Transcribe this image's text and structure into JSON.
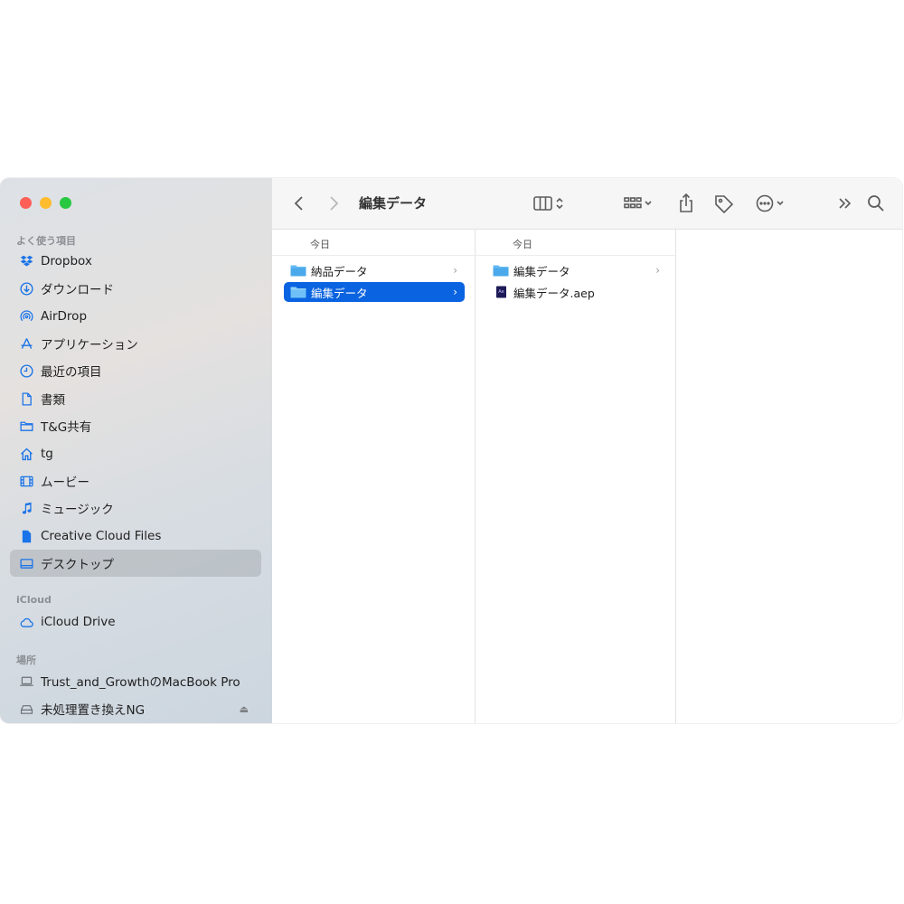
{
  "window": {
    "title": "編集データ"
  },
  "sidebar": {
    "favorites_header": "よく使う項目",
    "favorites": [
      {
        "label": "Dropbox",
        "icon": "dropbox-icon"
      },
      {
        "label": "ダウンロード",
        "icon": "download-icon"
      },
      {
        "label": "AirDrop",
        "icon": "airdrop-icon"
      },
      {
        "label": "アプリケーション",
        "icon": "applications-icon"
      },
      {
        "label": "最近の項目",
        "icon": "recents-clock-icon"
      },
      {
        "label": "書類",
        "icon": "document-icon"
      },
      {
        "label": "T&G共有",
        "icon": "folder-icon"
      },
      {
        "label": "tg",
        "icon": "home-icon"
      },
      {
        "label": "ムービー",
        "icon": "movies-film-icon"
      },
      {
        "label": "ミュージック",
        "icon": "music-note-icon"
      },
      {
        "label": "Creative Cloud Files",
        "icon": "file-icon"
      },
      {
        "label": "デスクトップ",
        "icon": "desktop-icon",
        "selected": true
      }
    ],
    "icloud_header": "iCloud",
    "icloud": [
      {
        "label": "iCloud Drive",
        "icon": "cloud-icon"
      }
    ],
    "locations_header": "場所",
    "locations": [
      {
        "label": "Trust_and_GrowthのMacBook Pro",
        "icon": "laptop-icon"
      },
      {
        "label": "未処理置き換えNG",
        "icon": "drive-icon"
      }
    ]
  },
  "columns": [
    {
      "header": "今日",
      "items": [
        {
          "name": "納品データ",
          "kind": "folder",
          "has_children": true,
          "selected": false
        },
        {
          "name": "編集データ",
          "kind": "folder",
          "has_children": true,
          "selected": true
        }
      ]
    },
    {
      "header": "今日",
      "items": [
        {
          "name": "編集データ",
          "kind": "folder",
          "has_children": true,
          "selected": false
        },
        {
          "name": "編集データ.aep",
          "kind": "aep-file",
          "has_children": false,
          "selected": false
        }
      ]
    }
  ],
  "colors": {
    "accent": "#0a63e0",
    "sidebar_icon": "#1a73e8",
    "folder": "#5ab4f0",
    "close": "#ff5f57",
    "minimize": "#febc2e",
    "zoom": "#28c840"
  }
}
